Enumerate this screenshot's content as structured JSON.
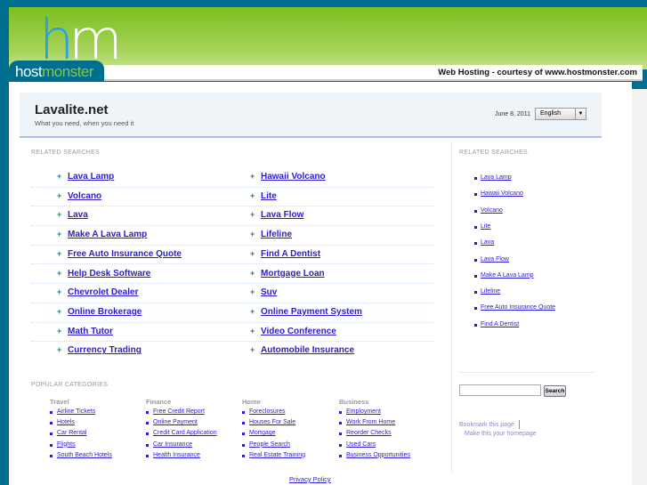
{
  "brand": {
    "logo_letters_h": "h",
    "logo_letters_m": "m",
    "tab_host": "host",
    "tab_monster": "monster",
    "courtesy": "Web Hosting - courtesy of www.hostmonster.com"
  },
  "header": {
    "title": "Lavalite.net",
    "tagline": "What you need, when you need it",
    "date": "June 8, 2011",
    "language": "English"
  },
  "related": {
    "heading": "RELATED SEARCHES",
    "left": [
      "Lava Lamp",
      "Volcano",
      "Lava",
      "Make A Lava Lamp",
      "Free Auto Insurance Quote",
      "Help Desk Software",
      "Chevrolet Dealer",
      "Online Brokerage",
      "Math Tutor",
      "Currency Trading"
    ],
    "right": [
      "Hawaii Volcano",
      "Lite",
      "Lava Flow",
      "Lifeline",
      "Find A Dentist",
      "Mortgage Loan",
      "Suv",
      "Online Payment System",
      "Video Conference",
      "Automobile Insurance"
    ]
  },
  "sidebar": {
    "heading": "RELATED SEARCHES",
    "items": [
      "Lava Lamp",
      "Hawaii Volcano",
      "Volcano",
      "Lite",
      "Lava",
      "Lava Flow",
      "Make A Lava Lamp",
      "Lifeline",
      "Free Auto Insurance Quote",
      "Find A Dentist"
    ],
    "search_button": "Search",
    "bookmark": "Bookmark this page",
    "homepage": "Make this your homepage"
  },
  "popular": {
    "heading": "POPULAR CATEGORIES",
    "columns": [
      {
        "title": "Travel",
        "items": [
          "Airline Tickets",
          "Hotels",
          "Car Rental",
          "Flights",
          "South Beach Hotels"
        ]
      },
      {
        "title": "Finance",
        "items": [
          "Free Credit Report",
          "Online Payment",
          "Credit Card Application",
          "Car Insurance",
          "Health Insurance"
        ]
      },
      {
        "title": "Home",
        "items": [
          "Foreclosures",
          "Houses For Sale",
          "Mortgage",
          "People Search",
          "Real Estate Training"
        ]
      },
      {
        "title": "Business",
        "items": [
          "Employment",
          "Work From Home",
          "Reorder Checks",
          "Used Cars",
          "Business Opportunities"
        ]
      }
    ]
  },
  "footer": {
    "privacy": "Privacy Policy"
  }
}
